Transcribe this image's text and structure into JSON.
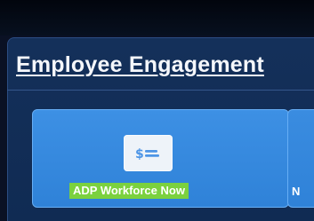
{
  "section": {
    "title": "Employee Engagement"
  },
  "tiles": [
    {
      "label": "ADP Workforce Now",
      "icon": "payroll-card-icon"
    },
    {
      "label": "N"
    }
  ],
  "colors": {
    "page_background": "#0a1124",
    "panel_background": "#14305a",
    "tile_background": "#3d90e4",
    "highlight": "#7bd13e",
    "text": "#ffffff"
  }
}
